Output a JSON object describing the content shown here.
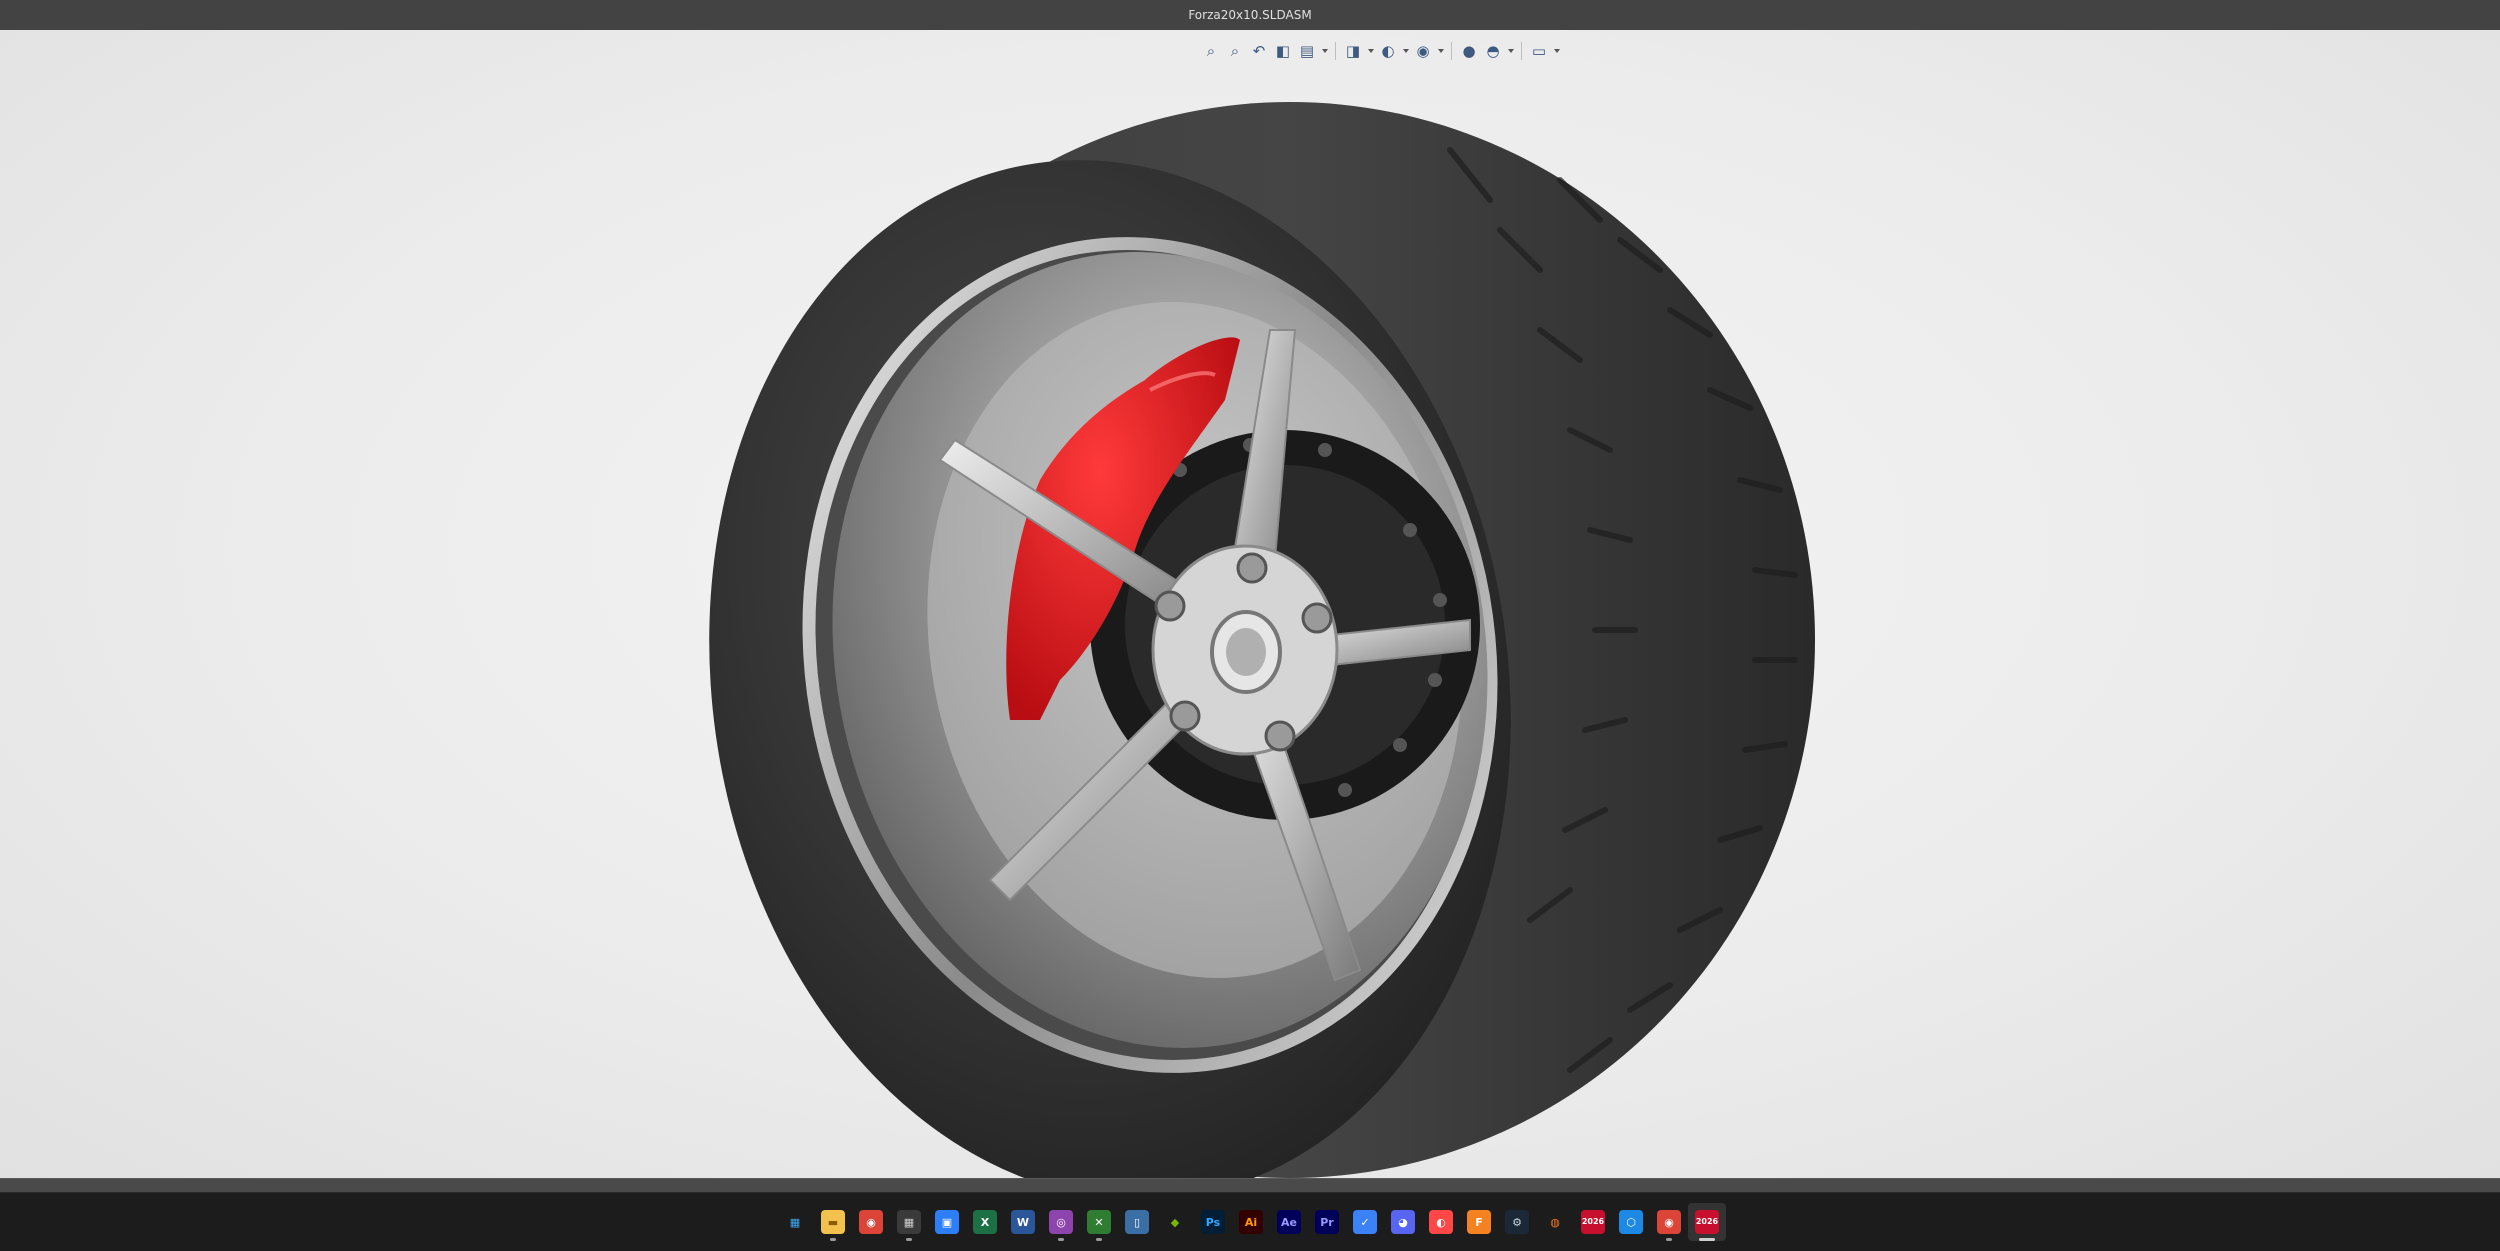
{
  "window": {
    "title": "Forza20x10.SLDASM"
  },
  "heads_up_toolbar": {
    "groups": [
      [
        {
          "name": "zoom-to-fit-icon",
          "glyph": "⌕",
          "caret": false
        },
        {
          "name": "zoom-to-area-icon",
          "glyph": "⌕",
          "caret": false
        },
        {
          "name": "previous-view-icon",
          "glyph": "↶",
          "caret": false
        },
        {
          "name": "section-view-icon",
          "glyph": "◧",
          "caret": false
        },
        {
          "name": "dynamic-annotation-icon",
          "glyph": "▤",
          "caret": true
        }
      ],
      [
        {
          "name": "view-orientation-icon",
          "glyph": "◨",
          "caret": true
        },
        {
          "name": "display-style-icon",
          "glyph": "◐",
          "caret": true
        },
        {
          "name": "hide-show-items-icon",
          "glyph": "◉",
          "caret": true
        }
      ],
      [
        {
          "name": "edit-appearance-icon",
          "glyph": "●",
          "caret": false
        },
        {
          "name": "apply-scene-icon",
          "glyph": "◓",
          "caret": true
        }
      ],
      [
        {
          "name": "view-settings-icon",
          "glyph": "▭",
          "caret": true
        }
      ]
    ]
  },
  "taskbar": {
    "items": [
      {
        "name": "start-icon",
        "label": "",
        "bg": "#1c1c1c",
        "fg": "#3fa9f5",
        "glyph": "▦",
        "running": false,
        "active": false
      },
      {
        "name": "file-explorer-icon",
        "label": "",
        "bg": "#f2c14e",
        "fg": "#8a5a00",
        "glyph": "▬",
        "running": true,
        "active": false
      },
      {
        "name": "chrome-icon",
        "label": "",
        "bg": "#db4437",
        "fg": "#ffffff",
        "glyph": "◉",
        "running": false,
        "active": false
      },
      {
        "name": "calculator-icon",
        "label": "",
        "bg": "#3a3a3a",
        "fg": "#d0d0d0",
        "glyph": "▦",
        "running": true,
        "active": false
      },
      {
        "name": "store-icon",
        "label": "",
        "bg": "#2d7ff9",
        "fg": "#ffffff",
        "glyph": "▣",
        "running": false,
        "active": false
      },
      {
        "name": "excel-icon",
        "label": "",
        "bg": "#1d7044",
        "fg": "#ffffff",
        "glyph": "X",
        "running": false,
        "active": false
      },
      {
        "name": "word-icon",
        "label": "",
        "bg": "#2b579a",
        "fg": "#ffffff",
        "glyph": "W",
        "running": false,
        "active": false
      },
      {
        "name": "camera-app-icon",
        "label": "",
        "bg": "#8e44ad",
        "fg": "#ffffff",
        "glyph": "◎",
        "running": true,
        "active": false
      },
      {
        "name": "xbox-icon",
        "label": "",
        "bg": "#2e7d32",
        "fg": "#ffffff",
        "glyph": "✕",
        "running": true,
        "active": false
      },
      {
        "name": "phone-link-icon",
        "label": "",
        "bg": "#3b6ea5",
        "fg": "#ffffff",
        "glyph": "▯",
        "running": false,
        "active": false
      },
      {
        "name": "nvidia-icon",
        "label": "",
        "bg": "#1c1c1c",
        "fg": "#76b900",
        "glyph": "◆",
        "running": false,
        "active": false
      },
      {
        "name": "photoshop-icon",
        "label": "Ps",
        "bg": "#001e36",
        "fg": "#31a8ff",
        "glyph": "",
        "running": false,
        "active": false
      },
      {
        "name": "illustrator-icon",
        "label": "Ai",
        "bg": "#330000",
        "fg": "#ff9a00",
        "glyph": "",
        "running": false,
        "active": false
      },
      {
        "name": "after-effects-icon",
        "label": "Ae",
        "bg": "#00005b",
        "fg": "#9999ff",
        "glyph": "",
        "running": false,
        "active": false
      },
      {
        "name": "premiere-icon",
        "label": "Pr",
        "bg": "#00005b",
        "fg": "#9999ff",
        "glyph": "",
        "running": false,
        "active": false
      },
      {
        "name": "mail-icon",
        "label": "",
        "bg": "#3b82f6",
        "fg": "#ffffff",
        "glyph": "✓",
        "running": false,
        "active": false
      },
      {
        "name": "discord-icon",
        "label": "",
        "bg": "#5865f2",
        "fg": "#ffffff",
        "glyph": "◕",
        "running": false,
        "active": false
      },
      {
        "name": "ea-app-icon",
        "label": "",
        "bg": "#ff4747",
        "fg": "#ffffff",
        "glyph": "◐",
        "running": false,
        "active": false
      },
      {
        "name": "fusion-icon",
        "label": "F",
        "bg": "#f58220",
        "fg": "#ffffff",
        "glyph": "",
        "running": false,
        "active": false
      },
      {
        "name": "steam-icon",
        "label": "",
        "bg": "#1b2838",
        "fg": "#c7d5e0",
        "glyph": "⚙",
        "running": false,
        "active": false
      },
      {
        "name": "blender-icon",
        "label": "",
        "bg": "#1c1c1c",
        "fg": "#f5792a",
        "glyph": "◍",
        "running": false,
        "active": false
      },
      {
        "name": "solidworks-2026-icon",
        "label": "2026",
        "bg": "#c8102e",
        "fg": "#ffffff",
        "glyph": "",
        "running": false,
        "active": false
      },
      {
        "name": "3d-viewer-icon",
        "label": "",
        "bg": "#1e88e5",
        "fg": "#ffffff",
        "glyph": "⬡",
        "running": false,
        "active": false
      },
      {
        "name": "chrome-profile-icon",
        "label": "",
        "bg": "#db4437",
        "fg": "#ffffff",
        "glyph": "◉",
        "running": true,
        "active": false
      },
      {
        "name": "solidworks-2026-running-icon",
        "label": "2026",
        "bg": "#c8102e",
        "fg": "#ffffff",
        "glyph": "",
        "running": true,
        "active": true
      }
    ]
  },
  "colors": {
    "caliper_red": "#e0141b",
    "rim_silver": "#c9c9c9",
    "tire_black": "#3a3a3a",
    "viewport_bg": "#ececec"
  }
}
